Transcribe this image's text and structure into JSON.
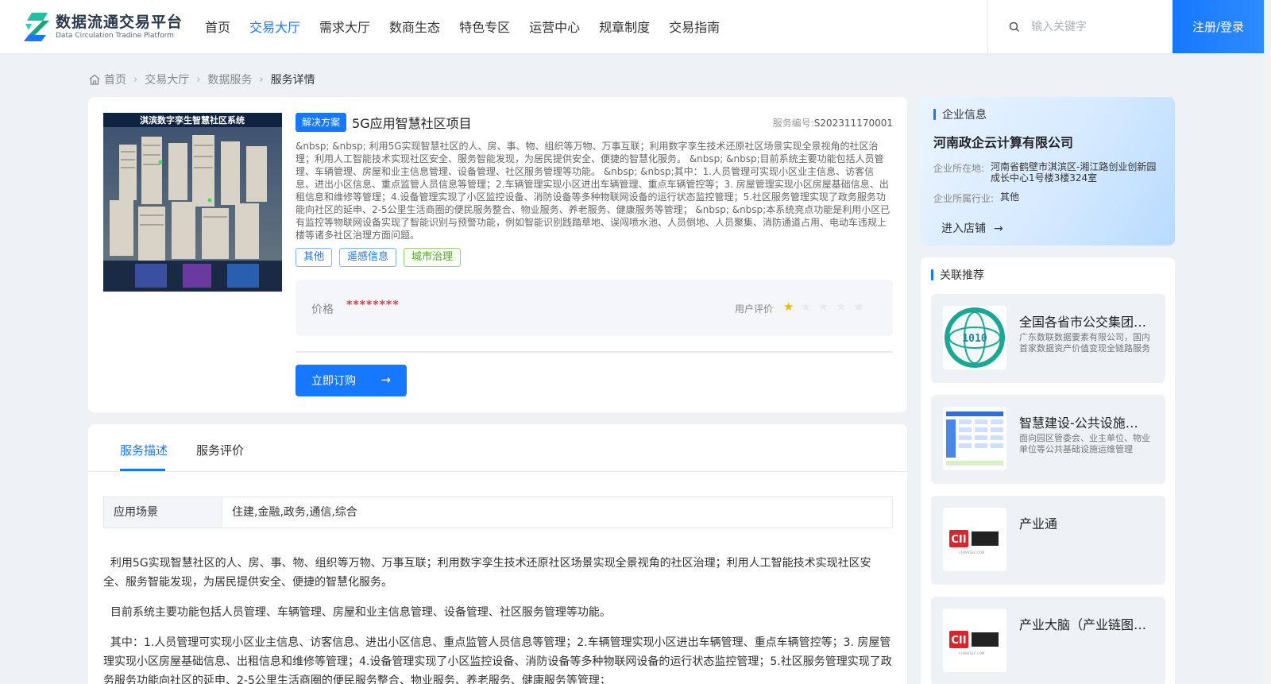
{
  "header": {
    "logo_cn": "数据流通交易平台",
    "logo_en": "Data Circulation Tradine Platform",
    "nav": [
      "首页",
      "交易大厅",
      "需求大厅",
      "数商生态",
      "特色专区",
      "运营中心",
      "规章制度",
      "交易指南"
    ],
    "active_nav": "交易大厅",
    "search_placeholder": "输入关键字",
    "login_label": "注册/登录"
  },
  "breadcrumb": [
    "首页",
    "交易大厅",
    "数据服务",
    "服务详情"
  ],
  "product": {
    "image_caption": "淇滨数字孪生智慧社区系统",
    "type_tag": "解决方案",
    "title": "5G应用智慧社区项目",
    "serial_label": "服务编号:",
    "serial_value": "S202311170001",
    "description": "&nbsp; &nbsp; 利用5G实现智慧社区的人、房、事、物、组织等万物、万事互联；利用数字孪生技术还原社区场景实现全景视角的社区治理；利用人工智能技术实现社区安全、服务智能发现，为居民提供安全、便捷的智慧化服务。 &nbsp; &nbsp;目前系统主要功能包括人员管理、车辆管理、房屋和业主信息管理、设备管理、社区服务管理等功能。 &nbsp; &nbsp;其中：1.人员管理可实现小区业主信息、访客信息、进出小区信息、重点监管人员信息等管理；2.车辆管理实现小区进出车辆管理、重点车辆管控等；3. 房屋管理实现小区房屋基础信息、出租信息和维修等管理；4.设备管理实现了小区监控设备、消防设备等多种物联网设备的运行状态监控管理；5.社区服务管理实现了政务服务功能向社区的延申、2-5公里生活商圈的便民服务整合、物业服务、养老服务、健康服务等管理； &nbsp; &nbsp;本系统亮点功能是利用小区已有监控等物联网设备实现了智能识别与预警功能，例如智能识别践踏草地、误闯喷水池、人员倒地、人员聚集、消防通道占用、电动车违规上楼等诸多社区治理方面问题。",
    "tags": [
      {
        "label": "其他",
        "color": "blue"
      },
      {
        "label": "遥感信息",
        "color": "blue"
      },
      {
        "label": "城市治理",
        "color": "green"
      }
    ],
    "price_label": "价格",
    "price_value": "********",
    "rating_label": "用户评价",
    "rating": 1,
    "rating_max": 5,
    "order_label": "立即订购",
    "accent_color": "#1677ff"
  },
  "details": {
    "tabs": [
      "服务描述",
      "服务评价"
    ],
    "active_tab": "服务描述",
    "scene_label": "应用场景",
    "scene_value": "住建,金融,政务,通信,综合",
    "paragraphs": [
      "  利用5G实现智慧社区的人、房、事、物、组织等万物、万事互联；利用数字孪生技术还原社区场景实现全景视角的社区治理；利用人工智能技术实现社区安全、服务智能发现，为居民提供安全、便捷的智慧化服务。",
      "  目前系统主要功能包括人员管理、车辆管理、房屋和业主信息管理、设备管理、社区服务管理等功能。",
      "  其中：1.人员管理可实现小区业主信息、访客信息、进出小区信息、重点监管人员信息等管理；2.车辆管理实现小区进出车辆管理、重点车辆管控等；3. 房屋管理实现小区房屋基础信息、出租信息和维修等管理；4.设备管理实现了小区监控设备、消防设备等多种物联网设备的运行状态监控管理；5.社区服务管理实现了政务服务功能向社区的延申、2-5公里生活商圈的便民服务整合、物业服务、养老服务、健康服务等管理；"
    ]
  },
  "enterprise": {
    "section_title": "企业信息",
    "name": "河南政企云计算有限公司",
    "location_label": "企业所在地:",
    "location_value": "河南省鹤壁市淇滨区-湘江路创业创新园成长中心1号楼3楼324室",
    "industry_label": "企业所属行业:",
    "industry_value": "其他",
    "enter_label": "进入店铺"
  },
  "recommend": {
    "section_title": "关联推荐",
    "items": [
      {
        "title": "全国各省市公交集团数据",
        "sub": "广东数联数据要素有限公司，国内首家数据资产价值变现全链路服务商",
        "icon": "data-globe-icon"
      },
      {
        "title": "智慧建设-公共设施智能运维",
        "sub": "面向园区管委会、业主单位、物业单位等公共基础设施运维管理",
        "icon": "diagram-thumb-icon"
      },
      {
        "title": "产业通",
        "sub": "",
        "icon": "shangqi-logo-icon"
      },
      {
        "title": "产业大脑（产业链图谱）",
        "sub": "",
        "icon": "shangqi-logo-icon"
      }
    ]
  }
}
